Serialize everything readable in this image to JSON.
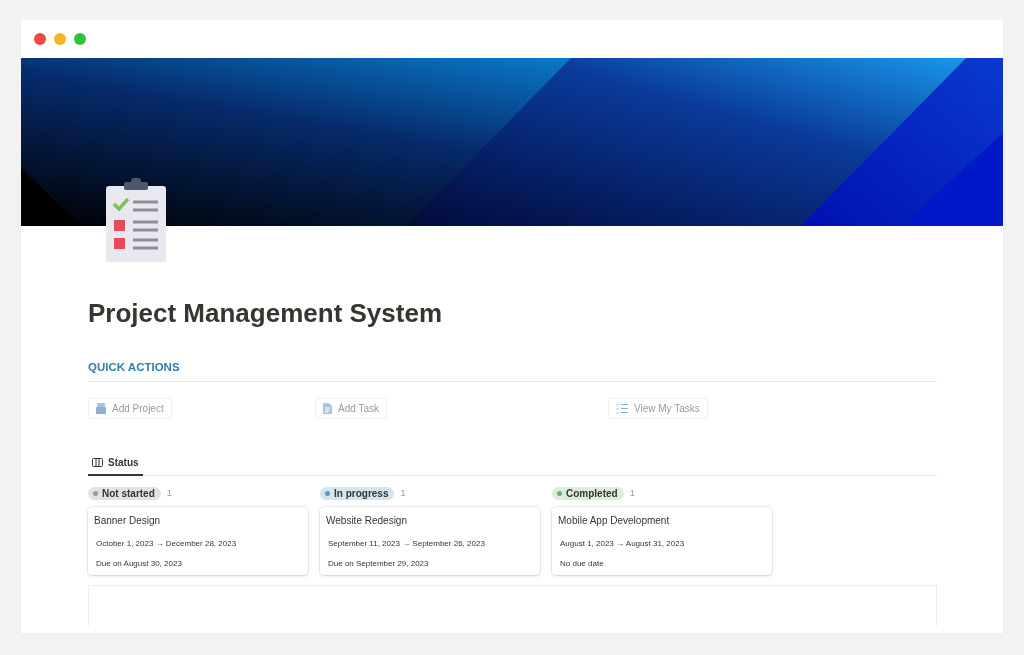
{
  "window": {
    "controls": [
      {
        "color": "#ed4a43"
      },
      {
        "color": "#f5b62a"
      },
      {
        "color": "#2ec23e"
      }
    ]
  },
  "title": "Project Management System",
  "quick_actions": {
    "heading": "QUICK ACTIONS",
    "buttons": [
      {
        "label": "Add Project",
        "kind": "box"
      },
      {
        "label": "Add Task",
        "kind": "document"
      },
      {
        "label": "View My Tasks",
        "kind": "checklist"
      }
    ]
  },
  "views": [
    {
      "label": "Status",
      "selected": true
    }
  ],
  "board": {
    "groups": [
      {
        "status": "Not started",
        "count": "1",
        "color": "#9b9a97",
        "cards": [
          {
            "title": "Banner Design",
            "dates": "October 1, 2023 → December 28, 2023",
            "due": "Due on August 30, 2023"
          }
        ]
      },
      {
        "status": "In progress",
        "count": "1",
        "color": "#5a9ac9",
        "cards": [
          {
            "title": "Website Redesign",
            "dates": "September 11, 2023 → September 26, 2023",
            "due": "Due on September 29, 2023"
          }
        ]
      },
      {
        "status": "Completed",
        "count": "1",
        "color": "#6aae7b",
        "cards": [
          {
            "title": "Mobile App Development",
            "dates": "August 1, 2023 → August 31, 2023",
            "due": "No due date"
          }
        ]
      }
    ]
  }
}
